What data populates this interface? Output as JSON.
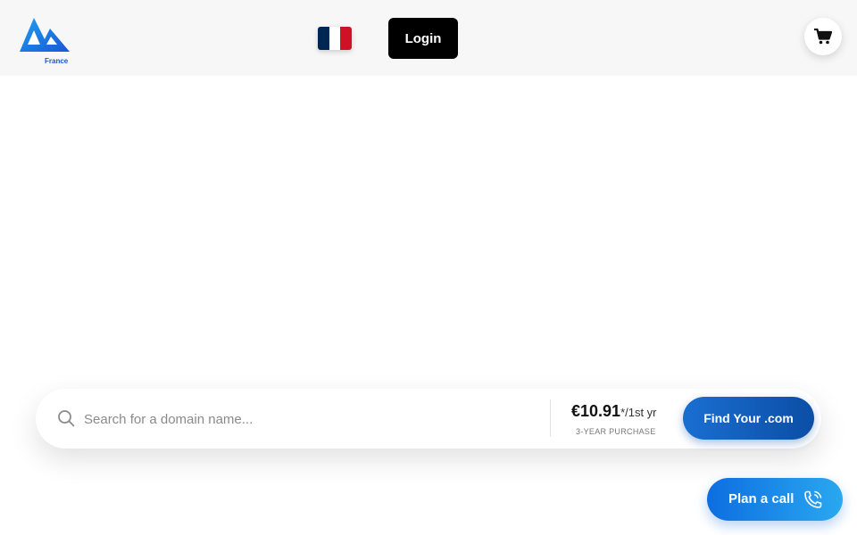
{
  "header": {
    "logo_sub": "France",
    "login_label": "Login"
  },
  "flag": {
    "colors": [
      "#002654",
      "#ffffff",
      "#ce1126"
    ]
  },
  "search": {
    "placeholder": "Search for a domain name...",
    "price": "€10.91",
    "price_suffix": "*/1st yr",
    "price_note": "3-YEAR PURCHASE",
    "button_label": "Find Your .com"
  },
  "call": {
    "label": "Plan a call"
  },
  "colors": {
    "brand_blue": "#1a56d6",
    "button_blue": "#0b4ea6",
    "call_gradient_start": "#0d6ee0",
    "call_gradient_end": "#2aa8f0"
  },
  "icons": [
    "logo-icon",
    "france-flag-icon",
    "cart-icon",
    "search-icon",
    "phone-icon"
  ]
}
